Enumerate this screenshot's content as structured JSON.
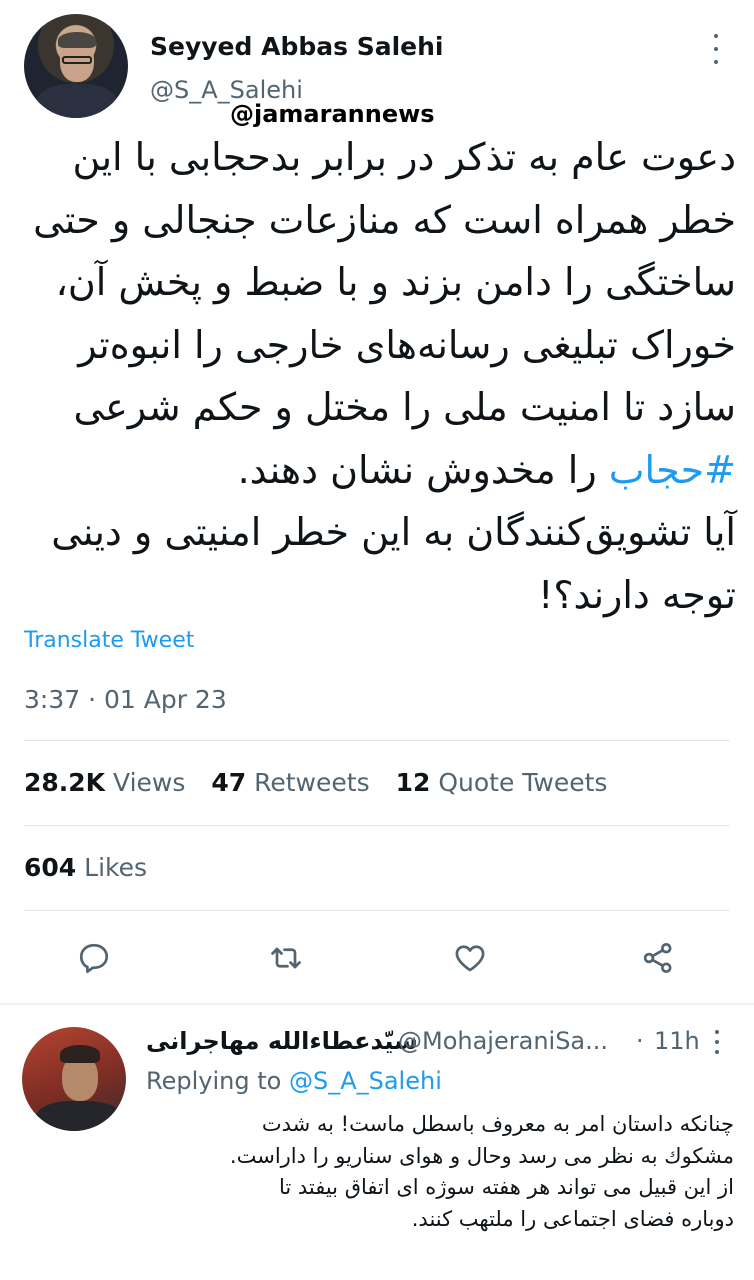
{
  "tweet": {
    "author_name": "Seyyed Abbas Salehi",
    "author_handle": "@S_A_Salehi",
    "watermark": "@jamarannews",
    "text_before_hashtag": "دعوت عام به تذکر در برابر بدحجابی با این خطر همراه است که منازعات جنجالی و حتی ساختگی را دامن بزند و با ضبط و پخش آن، خوراک تبلیغی رسانه‌های خارجی را انبوه‌تر سازد تا امنیت ملی را مختل و حکم شرعی ",
    "hashtag": "#حجاب",
    "text_after_hashtag": " را مخدوش نشان دهند.",
    "second_paragraph": "آیا تشویق‌کنندگان به این خطر امنیتی و دینی توجه دارند؟!",
    "translate_label": "Translate Tweet",
    "timestamp": "3:37 · 01 Apr 23",
    "stats": {
      "views_count": "28.2K",
      "views_label": "Views",
      "retweets_count": "47",
      "retweets_label": "Retweets",
      "quotes_count": "12",
      "quotes_label": "Quote Tweets",
      "likes_count": "604",
      "likes_label": "Likes"
    },
    "icons": {
      "reply": "reply-icon",
      "retweet": "retweet-icon",
      "like": "heart-icon",
      "share": "share-icon"
    }
  },
  "reply": {
    "author_name": "سیّدعطاءالله مهاجرانی",
    "author_handle": "@MohajeraniSa...",
    "dot": "·",
    "time": "11h",
    "replying_prefix": "Replying to",
    "replying_to": "@S_A_Salehi",
    "text_line1": "چنانکه داستان امر به معروف باسطل ماست! به شدت",
    "text_line2": "مشکوك به نظر می رسد وحال و هوای سناریو  را داراست.",
    "text_line3": "از این قبیل می تواند هر هفته سوژه ای اتفاق بیفتد تا",
    "text_line4": "دوباره فضای اجتماعی را ملتهب کنند."
  },
  "colors": {
    "accent": "#1d9bf0",
    "text_primary": "#0f1419",
    "text_secondary": "#536471",
    "divider": "#e1e6ea"
  }
}
